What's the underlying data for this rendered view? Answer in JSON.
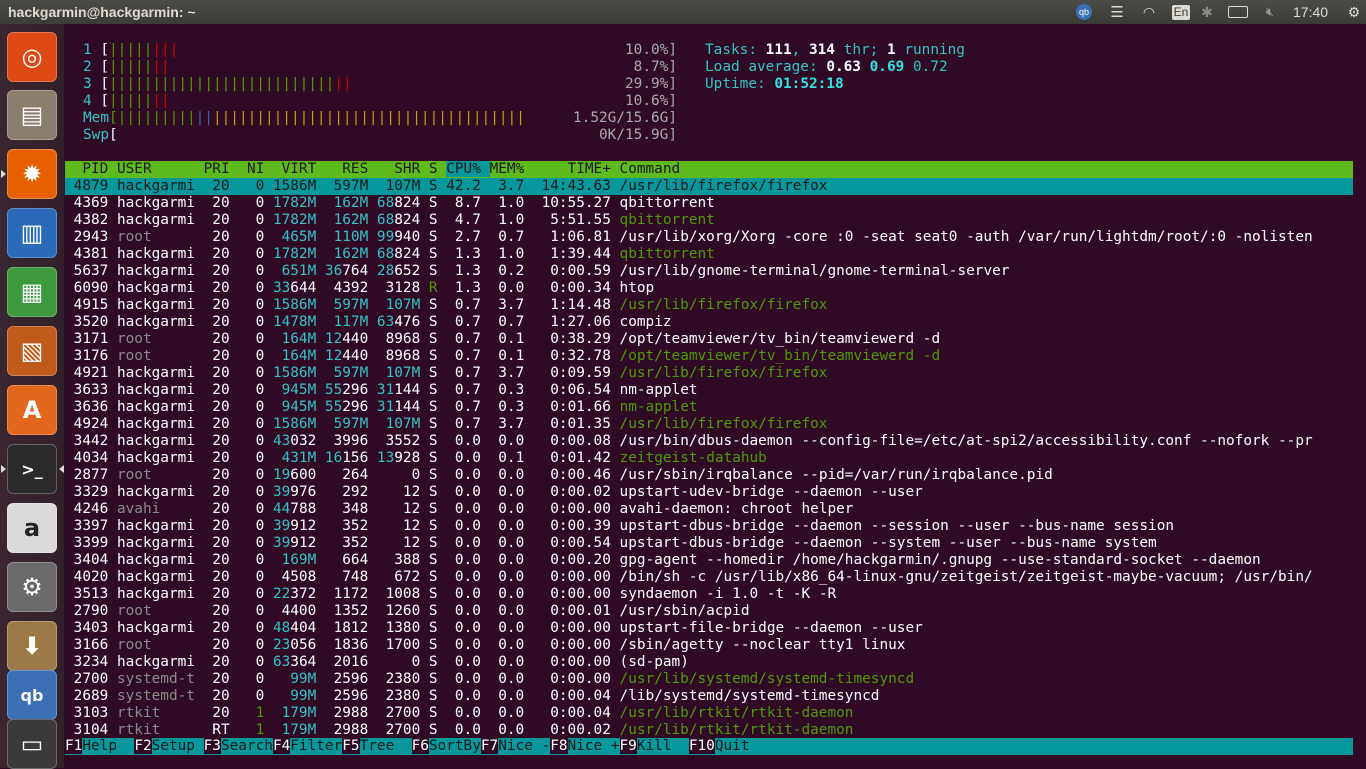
{
  "topbar": {
    "title": "hackgarmin@hackgarmin: ~",
    "lang": "En",
    "clock": "17:40"
  },
  "launcher": {
    "items": [
      {
        "name": "ubuntu-dash-icon",
        "glyph": "◎",
        "bg": "#dd4814"
      },
      {
        "name": "files-icon",
        "glyph": "▤",
        "bg": "#8a7e6e"
      },
      {
        "name": "firefox-icon",
        "glyph": "✹",
        "bg": "#e66000"
      },
      {
        "name": "libreoffice-writer-icon",
        "glyph": "▥",
        "bg": "#2a6ab8"
      },
      {
        "name": "libreoffice-calc-icon",
        "glyph": "▦",
        "bg": "#3c9a3c"
      },
      {
        "name": "libreoffice-impress-icon",
        "glyph": "▧",
        "bg": "#c05a1a"
      },
      {
        "name": "software-center-icon",
        "glyph": "A",
        "bg": "#e2661b"
      },
      {
        "name": "terminal-icon",
        "glyph": ">_",
        "bg": "#2b2b2b"
      },
      {
        "name": "amazon-icon",
        "glyph": "a",
        "bg": "#d9d9d9"
      },
      {
        "name": "system-settings-icon",
        "glyph": "⚙",
        "bg": "#6a6a6a"
      },
      {
        "name": "archive-manager-icon",
        "glyph": "⬇",
        "bg": "#9c7a45"
      },
      {
        "name": "qbittorrent-icon",
        "glyph": "qb",
        "bg": "#3b6fb6"
      },
      {
        "name": "printer-icon",
        "glyph": "▭",
        "bg": "#3a3a3a"
      }
    ]
  },
  "meters": {
    "cpu": [
      {
        "id": "1",
        "bar": "[|||||",
        "bar2": "|||",
        "pct": "10.0%]"
      },
      {
        "id": "2",
        "bar": "[|||||",
        "bar2": "||",
        "pct": "8.7%]"
      },
      {
        "id": "3",
        "bar": "[||||||||||||||||||||||||||",
        "bar2": "||",
        "pct": "29.9%]"
      },
      {
        "id": "4",
        "bar": "[|||||",
        "bar2": "||",
        "pct": "10.6%]"
      }
    ],
    "mem": {
      "label": "Mem",
      "bar": "[|||||||||",
      "bar2": "||",
      "bar3": "||||||||||||||||||||||||||||||||||||",
      "value": "1.52G/15.6G]"
    },
    "swp": {
      "label": "Swp",
      "bar": "[",
      "value": "0K/15.9G]"
    }
  },
  "summary": {
    "tasks_label": "Tasks:",
    "tasks": "111",
    "thr": "314",
    "thr_label": "thr;",
    "running": "1",
    "running_label": "running",
    "load_label": "Load average:",
    "load1": "0.63",
    "load5": "0.69",
    "load15": "0.72",
    "uptime_label": "Uptime:",
    "uptime": "01:52:18"
  },
  "header": {
    "pid": "  PID",
    "user": "USER",
    "pri": "PRI",
    "ni": "NI",
    "virt": "VIRT",
    "res": "RES",
    "shr": "SHR",
    "s": "S",
    "cpu": "CPU%",
    "mem": "MEM%",
    "time": "TIME+",
    "cmd": "Command"
  },
  "processes": [
    {
      "pid": "4879",
      "user": "hackgarmi",
      "pri": "20",
      "ni": "0",
      "virt": "1586M",
      "res": "597M",
      "shr": "107M",
      "s": "S",
      "cpu": "42.2",
      "mem": "3.7",
      "time": "14:43.63",
      "cmd": "/usr/lib/firefox/firefox",
      "sel": true
    },
    {
      "pid": "4369",
      "user": "hackgarmi",
      "pri": "20",
      "ni": "0",
      "virt": "1782M",
      "res": "162M",
      "shr": "68824",
      "s": "S",
      "cpu": "8.7",
      "mem": "1.0",
      "time": "10:55.27",
      "cmd": "qbittorrent"
    },
    {
      "pid": "4382",
      "user": "hackgarmi",
      "pri": "20",
      "ni": "0",
      "virt": "1782M",
      "res": "162M",
      "shr": "68824",
      "s": "S",
      "cpu": "4.7",
      "mem": "1.0",
      "time": "5:51.55",
      "cmd": "qbittorrent",
      "thread": true
    },
    {
      "pid": "2943",
      "user": "root",
      "pri": "20",
      "ni": "0",
      "virt": "465M",
      "res": "110M",
      "shr": "99940",
      "s": "S",
      "cpu": "2.7",
      "mem": "0.7",
      "time": "1:06.81",
      "cmd": "/usr/lib/xorg/Xorg -core :0 -seat seat0 -auth /var/run/lightdm/root/:0 -nolisten"
    },
    {
      "pid": "4381",
      "user": "hackgarmi",
      "pri": "20",
      "ni": "0",
      "virt": "1782M",
      "res": "162M",
      "shr": "68824",
      "s": "S",
      "cpu": "1.3",
      "mem": "1.0",
      "time": "1:39.44",
      "cmd": "qbittorrent",
      "thread": true
    },
    {
      "pid": "5637",
      "user": "hackgarmi",
      "pri": "20",
      "ni": "0",
      "virt": "651M",
      "res": "36764",
      "shr": "28652",
      "s": "S",
      "cpu": "1.3",
      "mem": "0.2",
      "time": "0:00.59",
      "cmd": "/usr/lib/gnome-terminal/gnome-terminal-server"
    },
    {
      "pid": "6090",
      "user": "hackgarmi",
      "pri": "20",
      "ni": "0",
      "virt": "33644",
      "res": "4392",
      "shr": "3128",
      "s": "R",
      "cpu": "1.3",
      "mem": "0.0",
      "time": "0:00.34",
      "cmd": "htop"
    },
    {
      "pid": "4915",
      "user": "hackgarmi",
      "pri": "20",
      "ni": "0",
      "virt": "1586M",
      "res": "597M",
      "shr": "107M",
      "s": "S",
      "cpu": "0.7",
      "mem": "3.7",
      "time": "1:14.48",
      "cmd": "/usr/lib/firefox/firefox",
      "thread": true
    },
    {
      "pid": "3520",
      "user": "hackgarmi",
      "pri": "20",
      "ni": "0",
      "virt": "1478M",
      "res": "117M",
      "shr": "63476",
      "s": "S",
      "cpu": "0.7",
      "mem": "0.7",
      "time": "1:27.06",
      "cmd": "compiz"
    },
    {
      "pid": "3171",
      "user": "root",
      "pri": "20",
      "ni": "0",
      "virt": "164M",
      "res": "12440",
      "shr": "8968",
      "s": "S",
      "cpu": "0.7",
      "mem": "0.1",
      "time": "0:38.29",
      "cmd": "/opt/teamviewer/tv_bin/teamviewerd -d"
    },
    {
      "pid": "3176",
      "user": "root",
      "pri": "20",
      "ni": "0",
      "virt": "164M",
      "res": "12440",
      "shr": "8968",
      "s": "S",
      "cpu": "0.7",
      "mem": "0.1",
      "time": "0:32.78",
      "cmd": "/opt/teamviewer/tv_bin/teamviewerd -d",
      "thread": true
    },
    {
      "pid": "4921",
      "user": "hackgarmi",
      "pri": "20",
      "ni": "0",
      "virt": "1586M",
      "res": "597M",
      "shr": "107M",
      "s": "S",
      "cpu": "0.7",
      "mem": "3.7",
      "time": "0:09.59",
      "cmd": "/usr/lib/firefox/firefox",
      "thread": true
    },
    {
      "pid": "3633",
      "user": "hackgarmi",
      "pri": "20",
      "ni": "0",
      "virt": "945M",
      "res": "55296",
      "shr": "31144",
      "s": "S",
      "cpu": "0.7",
      "mem": "0.3",
      "time": "0:06.54",
      "cmd": "nm-applet"
    },
    {
      "pid": "3636",
      "user": "hackgarmi",
      "pri": "20",
      "ni": "0",
      "virt": "945M",
      "res": "55296",
      "shr": "31144",
      "s": "S",
      "cpu": "0.7",
      "mem": "0.3",
      "time": "0:01.66",
      "cmd": "nm-applet",
      "thread": true
    },
    {
      "pid": "4924",
      "user": "hackgarmi",
      "pri": "20",
      "ni": "0",
      "virt": "1586M",
      "res": "597M",
      "shr": "107M",
      "s": "S",
      "cpu": "0.7",
      "mem": "3.7",
      "time": "0:01.35",
      "cmd": "/usr/lib/firefox/firefox",
      "thread": true
    },
    {
      "pid": "3442",
      "user": "hackgarmi",
      "pri": "20",
      "ni": "0",
      "virt": "43032",
      "res": "3996",
      "shr": "3552",
      "s": "S",
      "cpu": "0.0",
      "mem": "0.0",
      "time": "0:00.08",
      "cmd": "/usr/bin/dbus-daemon --config-file=/etc/at-spi2/accessibility.conf --nofork --pr"
    },
    {
      "pid": "4034",
      "user": "hackgarmi",
      "pri": "20",
      "ni": "0",
      "virt": "431M",
      "res": "16156",
      "shr": "13928",
      "s": "S",
      "cpu": "0.0",
      "mem": "0.1",
      "time": "0:01.42",
      "cmd": "zeitgeist-datahub",
      "thread": true
    },
    {
      "pid": "2877",
      "user": "root",
      "pri": "20",
      "ni": "0",
      "virt": "19600",
      "res": "264",
      "shr": "0",
      "s": "S",
      "cpu": "0.0",
      "mem": "0.0",
      "time": "0:00.46",
      "cmd": "/usr/sbin/irqbalance --pid=/var/run/irqbalance.pid"
    },
    {
      "pid": "3329",
      "user": "hackgarmi",
      "pri": "20",
      "ni": "0",
      "virt": "39976",
      "res": "292",
      "shr": "12",
      "s": "S",
      "cpu": "0.0",
      "mem": "0.0",
      "time": "0:00.02",
      "cmd": "upstart-udev-bridge --daemon --user"
    },
    {
      "pid": "4246",
      "user": "avahi",
      "pri": "20",
      "ni": "0",
      "virt": "44788",
      "res": "348",
      "shr": "12",
      "s": "S",
      "cpu": "0.0",
      "mem": "0.0",
      "time": "0:00.00",
      "cmd": "avahi-daemon: chroot helper"
    },
    {
      "pid": "3397",
      "user": "hackgarmi",
      "pri": "20",
      "ni": "0",
      "virt": "39912",
      "res": "352",
      "shr": "12",
      "s": "S",
      "cpu": "0.0",
      "mem": "0.0",
      "time": "0:00.39",
      "cmd": "upstart-dbus-bridge --daemon --session --user --bus-name session"
    },
    {
      "pid": "3399",
      "user": "hackgarmi",
      "pri": "20",
      "ni": "0",
      "virt": "39912",
      "res": "352",
      "shr": "12",
      "s": "S",
      "cpu": "0.0",
      "mem": "0.0",
      "time": "0:00.54",
      "cmd": "upstart-dbus-bridge --daemon --system --user --bus-name system"
    },
    {
      "pid": "3404",
      "user": "hackgarmi",
      "pri": "20",
      "ni": "0",
      "virt": "169M",
      "res": "664",
      "shr": "388",
      "s": "S",
      "cpu": "0.0",
      "mem": "0.0",
      "time": "0:00.20",
      "cmd": "gpg-agent --homedir /home/hackgarmin/.gnupg --use-standard-socket --daemon"
    },
    {
      "pid": "4020",
      "user": "hackgarmi",
      "pri": "20",
      "ni": "0",
      "virt": "4508",
      "res": "748",
      "shr": "672",
      "s": "S",
      "cpu": "0.0",
      "mem": "0.0",
      "time": "0:00.00",
      "cmd": "/bin/sh -c /usr/lib/x86_64-linux-gnu/zeitgeist/zeitgeist-maybe-vacuum; /usr/bin/"
    },
    {
      "pid": "3513",
      "user": "hackgarmi",
      "pri": "20",
      "ni": "0",
      "virt": "22372",
      "res": "1172",
      "shr": "1008",
      "s": "S",
      "cpu": "0.0",
      "mem": "0.0",
      "time": "0:00.00",
      "cmd": "syndaemon -i 1.0 -t -K -R"
    },
    {
      "pid": "2790",
      "user": "root",
      "pri": "20",
      "ni": "0",
      "virt": "4400",
      "res": "1352",
      "shr": "1260",
      "s": "S",
      "cpu": "0.0",
      "mem": "0.0",
      "time": "0:00.01",
      "cmd": "/usr/sbin/acpid"
    },
    {
      "pid": "3403",
      "user": "hackgarmi",
      "pri": "20",
      "ni": "0",
      "virt": "48404",
      "res": "1812",
      "shr": "1380",
      "s": "S",
      "cpu": "0.0",
      "mem": "0.0",
      "time": "0:00.00",
      "cmd": "upstart-file-bridge --daemon --user"
    },
    {
      "pid": "3166",
      "user": "root",
      "pri": "20",
      "ni": "0",
      "virt": "23056",
      "res": "1836",
      "shr": "1700",
      "s": "S",
      "cpu": "0.0",
      "mem": "0.0",
      "time": "0:00.00",
      "cmd": "/sbin/agetty --noclear tty1 linux"
    },
    {
      "pid": "3234",
      "user": "hackgarmi",
      "pri": "20",
      "ni": "0",
      "virt": "63364",
      "res": "2016",
      "shr": "0",
      "s": "S",
      "cpu": "0.0",
      "mem": "0.0",
      "time": "0:00.00",
      "cmd": "(sd-pam)"
    },
    {
      "pid": "2700",
      "user": "systemd-t",
      "pri": "20",
      "ni": "0",
      "virt": "99M",
      "res": "2596",
      "shr": "2380",
      "s": "S",
      "cpu": "0.0",
      "mem": "0.0",
      "time": "0:00.00",
      "cmd": "/usr/lib/systemd/systemd-timesyncd",
      "thread": true
    },
    {
      "pid": "2689",
      "user": "systemd-t",
      "pri": "20",
      "ni": "0",
      "virt": "99M",
      "res": "2596",
      "shr": "2380",
      "s": "S",
      "cpu": "0.0",
      "mem": "0.0",
      "time": "0:00.04",
      "cmd": "/lib/systemd/systemd-timesyncd"
    },
    {
      "pid": "3103",
      "user": "rtkit",
      "pri": "20",
      "ni": "1",
      "virt": "179M",
      "res": "2988",
      "shr": "2700",
      "s": "S",
      "cpu": "0.0",
      "mem": "0.0",
      "time": "0:00.04",
      "cmd": "/usr/lib/rtkit/rtkit-daemon",
      "thread": true
    },
    {
      "pid": "3104",
      "user": "rtkit",
      "pri": "RT",
      "ni": "1",
      "virt": "179M",
      "res": "2988",
      "shr": "2700",
      "s": "S",
      "cpu": "0.0",
      "mem": "0.0",
      "time": "0:00.02",
      "cmd": "/usr/lib/rtkit/rtkit-daemon",
      "thread": true
    }
  ],
  "fkeys": [
    {
      "key": "F1",
      "label": "Help  "
    },
    {
      "key": "F2",
      "label": "Setup "
    },
    {
      "key": "F3",
      "label": "Search"
    },
    {
      "key": "F4",
      "label": "Filter"
    },
    {
      "key": "F5",
      "label": "Tree  "
    },
    {
      "key": "F6",
      "label": "SortBy"
    },
    {
      "key": "F7",
      "label": "Nice -"
    },
    {
      "key": "F8",
      "label": "Nice +"
    },
    {
      "key": "F9",
      "label": "Kill  "
    },
    {
      "key": "F10",
      "label": "Quit  "
    }
  ]
}
